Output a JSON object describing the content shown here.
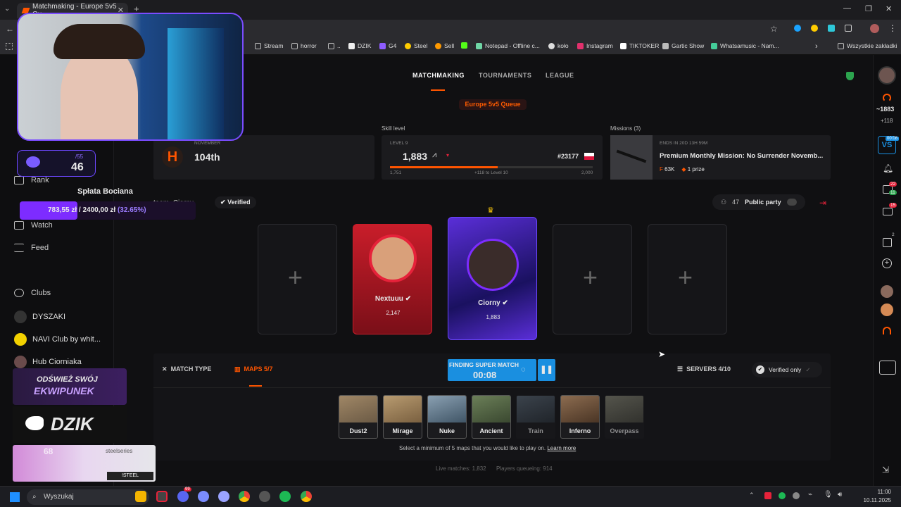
{
  "browser": {
    "tab_title": "Matchmaking - Europe 5v5 Qu...",
    "bookmarks": [
      "Stream",
      "horror",
      "..",
      "DZIK",
      "G4",
      "Steel",
      "Sell",
      "Notepad - Offline c...",
      "koło",
      "Instagram",
      "TIKTOKER",
      "Gartic Show",
      "Whatsamusic - Nam..."
    ],
    "all_bookmarks": "Wszystkie zakładki",
    "window_controls": [
      "—",
      "❐",
      "✕"
    ]
  },
  "topnav": {
    "tabs": [
      "MATCHMAKING",
      "TOURNAMENTS",
      "LEAGUE"
    ],
    "active": "MATCHMAKING"
  },
  "queue": "Europe 5v5 Queue",
  "season": {
    "label": "NOVEMBER",
    "rank": "104th"
  },
  "skill": {
    "section_label": "Skill level",
    "level": "LEVEL 9",
    "elo": "1,883",
    "rank_num": "#23177",
    "min": "1,751",
    "progress_note": "+118 to Level 10",
    "max": "2,000",
    "progress": 0.53
  },
  "missions": {
    "section_label": "Missions (3)",
    "ends": "ENDS IN 20D 13H 59M",
    "title": "Premium Monthly Mission: No Surrender Novemb...",
    "points": "63K",
    "prize": "1 prize"
  },
  "party": {
    "team": "team_Ciorny",
    "verified": "Verified",
    "online_count": "47",
    "public_label": "Public party"
  },
  "players": [
    {
      "name": "Nextuuu",
      "elo": "2,147",
      "icon": "verified-icon"
    },
    {
      "name": "Ciorny",
      "elo": "1,883",
      "icon": "verified-icon"
    }
  ],
  "matchbar": {
    "match_type": "MATCH TYPE",
    "maps": "MAPS 5/7",
    "finding": "FINDING SUPER MATCH",
    "timer": "00:08",
    "servers": "SERVERS 4/10",
    "verified_only": "Verified only"
  },
  "maps": [
    {
      "name": "Dust2",
      "on": true
    },
    {
      "name": "Mirage",
      "on": true
    },
    {
      "name": "Nuke",
      "on": true
    },
    {
      "name": "Ancient",
      "on": true
    },
    {
      "name": "Train",
      "on": false
    },
    {
      "name": "Inferno",
      "on": true
    },
    {
      "name": "Overpass",
      "on": false
    }
  ],
  "map_hint": "Select a minimum of 5 maps that you would like to play on.",
  "learn_more": "Learn more",
  "stats": {
    "live": "Live matches: 1,832",
    "queue": "Players queueing: 914"
  },
  "leftnav": {
    "items": [
      "Rank",
      "Watch",
      "Feed"
    ],
    "clubs_header": "Clubs",
    "clubs": [
      "DYSZAKI",
      "NAVI Club by whit...",
      "Hub Ciorniaka"
    ]
  },
  "stream_overlay": {
    "level_frac": "/55",
    "level": "46",
    "donation_title": "Spłata Bociana",
    "donation_amount": "783,55 zł  /  2400,00 zł",
    "donation_pct": "(32.65%)",
    "donation_progress": 0.3265,
    "promo1": "ODŚWIEŻ SWÓJ",
    "promo2": "EKWIPUNEK",
    "dzik": "DZIK",
    "steelseries": "steelseries",
    "steel_code": "!STEEL",
    "num68": "68"
  },
  "rightbar": {
    "elo": "~1883",
    "delta": "+118",
    "badge_notif": "22",
    "badge_chat": "11",
    "badge_msg": "15",
    "badge_group": "2",
    "vs_label": "00:08"
  },
  "taskbar": {
    "search": "Wyszukaj",
    "time": "11:00",
    "date": "10.11.2025",
    "badge": "99"
  },
  "colors": {
    "accent": "#ff5500",
    "blue": "#1a8fe0",
    "bg": "#101012"
  }
}
